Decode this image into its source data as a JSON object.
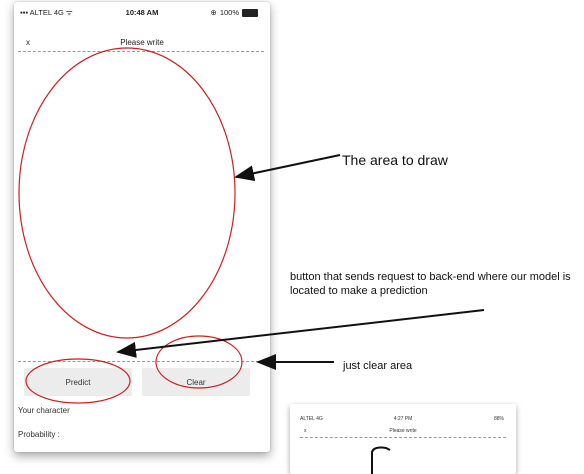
{
  "status_bar": {
    "carrier": "ALTEL 4G",
    "time": "10:48 AM",
    "battery": "100%"
  },
  "navbar": {
    "close_label": "x",
    "title": "Please write"
  },
  "buttons": {
    "predict_label": "Predict",
    "clear_label": "Clear"
  },
  "results": {
    "character_label": "Your character",
    "probability_label": "Probability :"
  },
  "annotations": {
    "draw_area": "The area to draw",
    "predict_button": "button that sends request to back-end where our model is located to make a prediction",
    "clear_button": "just clear area"
  },
  "thumbnail": {
    "carrier": "ALTEL 4G",
    "time": "4:27 PM",
    "battery": "88%",
    "close_label": "x",
    "title": "Please write"
  },
  "colors": {
    "highlight": "#cc1f1f",
    "button_bg": "#ececec",
    "arrow": "#111111"
  }
}
